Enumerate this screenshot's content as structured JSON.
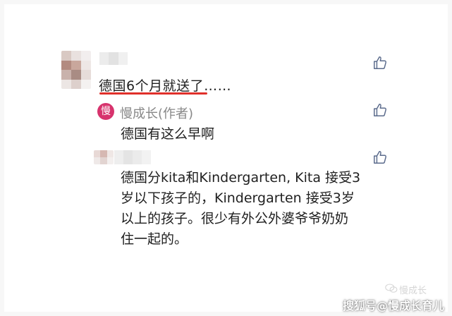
{
  "colors": {
    "underline": "#e0302a",
    "author_badge": "#d7336d",
    "text": "#1f1f1f",
    "author_name": "#888888",
    "like_icon": "#5b6b8c"
  },
  "comments": [
    {
      "text": "德国6个月就送了……",
      "like_icon": "thumbs-up-icon"
    },
    {
      "author_badge": "慢",
      "author": "慢成长(作者)",
      "text": "德国有这么早啊",
      "like_icon": "thumbs-up-icon"
    },
    {
      "lines": [
        "德国分kita和Kindergarten, Kita 接受3",
        "岁以下孩子的，Kindergarten 接受3岁",
        "以上的孩子。很少有外公外婆爷爷奶奶",
        "住一起的。"
      ],
      "like_icon": "thumbs-up-icon"
    }
  ],
  "watermark": {
    "channel": "慢成长",
    "source": "搜狐号@慢成长育儿"
  }
}
